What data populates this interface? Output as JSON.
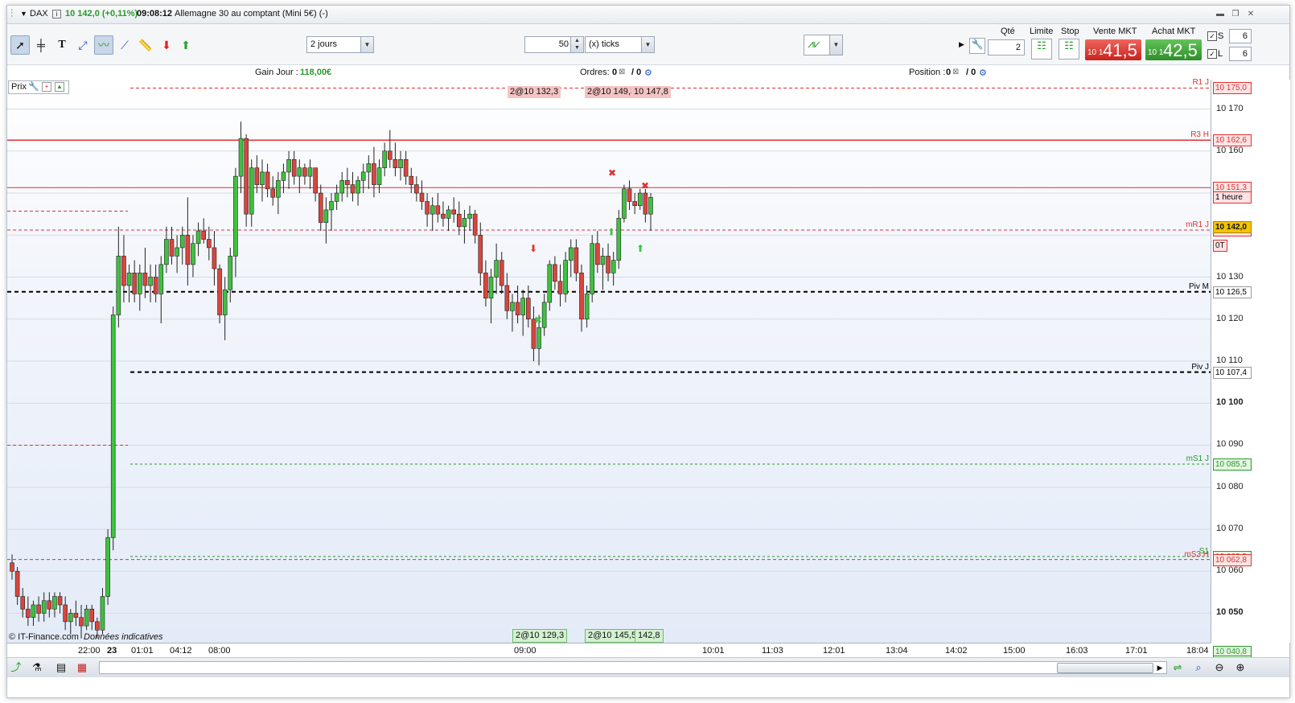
{
  "window": {
    "instrument": "DAX",
    "price_change": "10 142,0 (+0,11%)",
    "time": "09:08:12",
    "description": "Allemagne 30 au comptant (Mini 5€) (-)"
  },
  "toolbar": {
    "period": "2 jours",
    "ticks_value": "50",
    "ticks_unit": "(x) ticks",
    "qty_label": "Qté",
    "qty_value": "2",
    "limit_label": "Limite",
    "stop_label": "Stop",
    "sell_label": "Vente MKT",
    "sell_small": "10 1",
    "sell_big": "41,5",
    "buy_label": "Achat MKT",
    "buy_small": "10 1",
    "buy_big": "42,5",
    "s_label": "S",
    "s_value": "6",
    "l_label": "L",
    "l_value": "6"
  },
  "infobar": {
    "gain_label": "Gain Jour :",
    "gain_value": "118,00€",
    "orders_label": "Ordres:",
    "orders_a": "0",
    "orders_b": "/ 0",
    "position_label": "Position :",
    "position_a": "0",
    "position_b": "/ 0"
  },
  "chart": {
    "prix_label": "Prix",
    "copyright": "© IT-Finance.com",
    "disclaimer": "Données indicatives",
    "order_tags_top": [
      "2@10 132,3",
      "2@10 149,3",
      "10 147,8"
    ],
    "order_tags_bottom": [
      "2@10 129,3",
      "2@10 145,5",
      "142,8"
    ],
    "levels": [
      {
        "name": "R1 J",
        "value": "10 175,0",
        "color": "#e03030"
      },
      {
        "name": "R3 H",
        "value": "10 162,6",
        "color": "#e03030"
      },
      {
        "name": "",
        "value": "10 151,3",
        "color": "#e03030",
        "sub": "1 heure"
      },
      {
        "name": "mR1 J",
        "value": "10 141,2",
        "color": "#e03030"
      },
      {
        "name": "Piv M",
        "value": "10 126,5",
        "color": "#000000"
      },
      {
        "name": "Piv J",
        "value": "10 107,4",
        "color": "#000000"
      },
      {
        "name": "mS1 J",
        "value": "10 085,5",
        "color": "#2a9a2a"
      },
      {
        "name": "S1",
        "value": "10 063,5",
        "color": "#2a9a2a"
      },
      {
        "name": "mS3 H",
        "value": "10 062,8",
        "color": "#e03030"
      },
      {
        "name": "",
        "value": "10 040,8",
        "color": "#2a9a2a",
        "sub": "1 heure"
      }
    ],
    "last_price": "10 142,0",
    "ot_label": "0T",
    "y_ticks": [
      "10 170",
      "10 160",
      "10 150",
      "10 140",
      "10 130",
      "10 120",
      "10 110",
      "10 100",
      "10 090",
      "10 080",
      "10 070",
      "10 060",
      "10 050"
    ],
    "x_ticks": [
      "22:00",
      "23",
      "01:01",
      "04:12",
      "08:00",
      "09:00",
      "10:01",
      "11:03",
      "12:01",
      "13:04",
      "14:02",
      "15:00",
      "16:03",
      "17:01",
      "18:04"
    ]
  },
  "chart_data": {
    "type": "candlestick",
    "ylim": [
      10043,
      10177
    ],
    "last_price": 10142.0,
    "levels": [
      10175.0,
      10162.6,
      10151.3,
      10141.2,
      10126.5,
      10107.4,
      10085.5,
      10063.5,
      10062.8,
      10040.8
    ],
    "candles": [
      [
        10062,
        10064,
        10058,
        10060
      ],
      [
        10060,
        10061,
        10052,
        10054
      ],
      [
        10054,
        10056,
        10049,
        10051
      ],
      [
        10051,
        10054,
        10047,
        10049
      ],
      [
        10049,
        10053,
        10047,
        10052
      ],
      [
        10052,
        10054,
        10048,
        10050
      ],
      [
        10050,
        10055,
        10048,
        10053
      ],
      [
        10053,
        10055,
        10049,
        10051
      ],
      [
        10051,
        10055,
        10049,
        10054
      ],
      [
        10054,
        10055,
        10050,
        10052
      ],
      [
        10052,
        10054,
        10046,
        10048
      ],
      [
        10048,
        10051,
        10045,
        10050
      ],
      [
        10050,
        10053,
        10047,
        10049
      ],
      [
        10049,
        10052,
        10044,
        10047
      ],
      [
        10047,
        10052,
        10046,
        10051
      ],
      [
        10051,
        10052,
        10046,
        10048
      ],
      [
        10048,
        10049,
        10044,
        10046
      ],
      [
        10046,
        10056,
        10045,
        10054
      ],
      [
        10054,
        10070,
        10052,
        10068
      ],
      [
        10068,
        10123,
        10065,
        10121
      ],
      [
        10121,
        10142,
        10118,
        10135
      ],
      [
        10135,
        10140,
        10124,
        10128
      ],
      [
        10128,
        10133,
        10124,
        10131
      ],
      [
        10131,
        10134,
        10124,
        10126
      ],
      [
        10126,
        10133,
        10122,
        10131
      ],
      [
        10131,
        10137,
        10125,
        10128
      ],
      [
        10128,
        10133,
        10124,
        10130
      ],
      [
        10130,
        10133,
        10124,
        10126
      ],
      [
        10126,
        10135,
        10119,
        10133
      ],
      [
        10133,
        10142,
        10131,
        10139
      ],
      [
        10139,
        10142,
        10133,
        10135
      ],
      [
        10135,
        10140,
        10131,
        10137
      ],
      [
        10137,
        10142,
        10133,
        10140
      ],
      [
        10140,
        10149,
        10128,
        10133
      ],
      [
        10133,
        10140,
        10130,
        10138
      ],
      [
        10138,
        10143,
        10135,
        10141
      ],
      [
        10141,
        10144,
        10138,
        10139
      ],
      [
        10139,
        10142,
        10134,
        10137
      ],
      [
        10137,
        10141,
        10128,
        10132
      ],
      [
        10132,
        10133,
        10119,
        10121
      ],
      [
        10121,
        10130,
        10115,
        10127
      ],
      [
        10127,
        10137,
        10124,
        10135
      ],
      [
        10135,
        10156,
        10130,
        10154
      ],
      [
        10154,
        10167,
        10150,
        10163
      ],
      [
        10163,
        10164,
        10142,
        10145
      ],
      [
        10145,
        10158,
        10142,
        10156
      ],
      [
        10156,
        10159,
        10150,
        10152
      ],
      [
        10152,
        10158,
        10148,
        10155
      ],
      [
        10155,
        10157,
        10149,
        10151
      ],
      [
        10151,
        10154,
        10147,
        10149
      ],
      [
        10149,
        10155,
        10145,
        10153
      ],
      [
        10153,
        10157,
        10150,
        10155
      ],
      [
        10155,
        10160,
        10151,
        10158
      ],
      [
        10158,
        10160,
        10152,
        10154
      ],
      [
        10154,
        10158,
        10150,
        10156
      ],
      [
        10156,
        10157,
        10152,
        10154
      ],
      [
        10154,
        10158,
        10151,
        10156
      ],
      [
        10156,
        10156,
        10148,
        10150
      ],
      [
        10150,
        10152,
        10141,
        10143
      ],
      [
        10143,
        10149,
        10138,
        10146
      ],
      [
        10146,
        10150,
        10141,
        10148
      ],
      [
        10148,
        10152,
        10146,
        10150
      ],
      [
        10150,
        10155,
        10148,
        10153
      ],
      [
        10153,
        10156,
        10149,
        10152
      ],
      [
        10152,
        10155,
        10148,
        10150
      ],
      [
        10150,
        10154,
        10147,
        10153
      ],
      [
        10153,
        10157,
        10150,
        10155
      ],
      [
        10155,
        10159,
        10151,
        10157
      ],
      [
        10157,
        10161,
        10149,
        10152
      ],
      [
        10152,
        10158,
        10150,
        10156
      ],
      [
        10156,
        10162,
        10154,
        10160
      ],
      [
        10160,
        10165,
        10156,
        10158
      ],
      [
        10158,
        10162,
        10154,
        10156
      ],
      [
        10156,
        10160,
        10153,
        10158
      ],
      [
        10158,
        10160,
        10152,
        10154
      ],
      [
        10154,
        10156,
        10150,
        10152
      ],
      [
        10152,
        10154,
        10148,
        10150
      ],
      [
        10150,
        10153,
        10146,
        10148
      ],
      [
        10148,
        10150,
        10142,
        10145
      ],
      [
        10145,
        10149,
        10141,
        10147
      ],
      [
        10147,
        10150,
        10143,
        10145
      ],
      [
        10145,
        10148,
        10142,
        10144
      ],
      [
        10144,
        10147,
        10141,
        10146
      ],
      [
        10146,
        10149,
        10143,
        10145
      ],
      [
        10145,
        10148,
        10140,
        10142
      ],
      [
        10142,
        10146,
        10138,
        10144
      ],
      [
        10144,
        10147,
        10141,
        10145
      ],
      [
        10145,
        10146,
        10138,
        10140
      ],
      [
        10140,
        10143,
        10128,
        10131
      ],
      [
        10131,
        10134,
        10123,
        10125
      ],
      [
        10125,
        10132,
        10119,
        10130
      ],
      [
        10130,
        10138,
        10126,
        10134
      ],
      [
        10134,
        10136,
        10126,
        10128
      ],
      [
        10128,
        10131,
        10120,
        10122
      ],
      [
        10122,
        10126,
        10117,
        10124
      ],
      [
        10124,
        10128,
        10119,
        10121
      ],
      [
        10121,
        10127,
        10116,
        10125
      ],
      [
        10125,
        10128,
        10118,
        10120
      ],
      [
        10120,
        10123,
        10110,
        10113
      ],
      [
        10113,
        10121,
        10109,
        10118
      ],
      [
        10118,
        10126,
        10116,
        10124
      ],
      [
        10124,
        10134,
        10122,
        10133
      ],
      [
        10133,
        10135,
        10127,
        10129
      ],
      [
        10129,
        10133,
        10123,
        10126
      ],
      [
        10126,
        10136,
        10124,
        10134
      ],
      [
        10134,
        10139,
        10130,
        10137
      ],
      [
        10137,
        10139,
        10129,
        10131
      ],
      [
        10131,
        10133,
        10117,
        10120
      ],
      [
        10120,
        10128,
        10118,
        10126
      ],
      [
        10126,
        10140,
        10124,
        10138
      ],
      [
        10138,
        10141,
        10131,
        10133
      ],
      [
        10133,
        10137,
        10127,
        10135
      ],
      [
        10135,
        10138,
        10129,
        10131
      ],
      [
        10131,
        10136,
        10128,
        10134
      ],
      [
        10134,
        10146,
        10132,
        10144
      ],
      [
        10144,
        10152,
        10143,
        10151
      ],
      [
        10151,
        10153,
        10146,
        10148
      ],
      [
        10148,
        10150,
        10145,
        10147
      ],
      [
        10147,
        10151,
        10146,
        10150
      ],
      [
        10150,
        10151,
        10143,
        10145
      ],
      [
        10145,
        10150,
        10141,
        10149
      ]
    ]
  }
}
